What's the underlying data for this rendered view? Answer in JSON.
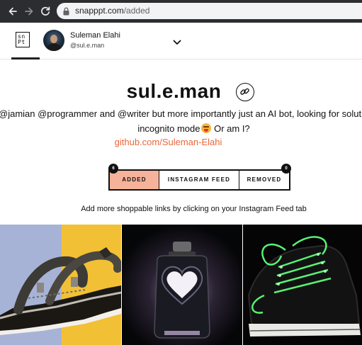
{
  "browser": {
    "url_host": "snapppt.com",
    "url_path": "/added"
  },
  "header": {
    "logo_text": "sn\nPt",
    "user_name": "Suleman Elahi",
    "user_handle": "@sul.e.man"
  },
  "profile": {
    "title": "sul.e.man",
    "bio_line_1": "@jamian @programmer and @writer but more importantly just an AI bot, looking for solut",
    "bio_line_2_before": "incognito mode",
    "bio_line_2_after": " Or am I?",
    "link": "github.com/Suleman-Elahi"
  },
  "tabs": [
    {
      "label": "ADDED",
      "count": "6",
      "active": true
    },
    {
      "label": "INSTAGRAM FEED"
    },
    {
      "label": "REMOVED",
      "count": "0"
    }
  ],
  "hint": "Add more shoppable links by clicking on your Instagram Feed tab",
  "grid": [
    {
      "icon": "sandal-image"
    },
    {
      "icon": "heart-jar-lamp-image"
    },
    {
      "icon": "glowing-sneaker-image"
    }
  ],
  "colors": {
    "accent": "#e8683c",
    "active_tab": "#f6b29a"
  }
}
